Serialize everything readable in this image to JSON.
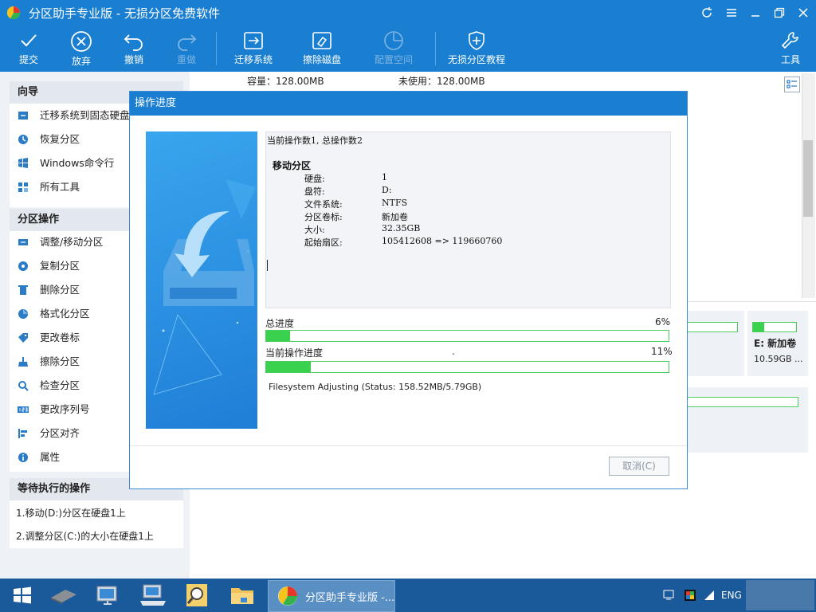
{
  "window": {
    "title": "分区助手专业版 - 无损分区免费软件"
  },
  "titlebar_controls": [
    "refresh-icon",
    "menu-icon",
    "minimize-icon",
    "restore-icon",
    "close-icon"
  ],
  "toolbar": {
    "commit": "提交",
    "discard": "放弃",
    "undo": "撤销",
    "redo": "重做",
    "migrate_os": "迁移系统",
    "wipe_disk": "擦除磁盘",
    "alloc_space": "配置空间",
    "tutorial": "无损分区教程",
    "tools": "工具"
  },
  "sidebar": {
    "wizard_header": "向导",
    "wizard_items": [
      "迁移系统到固态硬盘",
      "恢复分区",
      "Windows命令行",
      "所有工具"
    ],
    "partition_header": "分区操作",
    "partition_items": [
      "调整/移动分区",
      "复制分区",
      "删除分区",
      "格式化分区",
      "更改卷标",
      "擦除分区",
      "检查分区",
      "更改序列号",
      "分区对齐",
      "属性"
    ],
    "pending_header": "等待执行的操作",
    "pending_items": [
      "1.移动(D:)分区在硬盘1上",
      "2.调整分区(C:)的大小在硬盘1上"
    ]
  },
  "disk_info": {
    "capacity": "容量：128.00MB",
    "unused": "未使用：128.00MB"
  },
  "disk_map": {
    "e_label": "E: 新加卷",
    "e_size": "10.59GB ...",
    "e_usage_fraction": 0.25
  },
  "dialog": {
    "title": "操作进度",
    "log": {
      "header": "当前操作数1, 总操作数2",
      "op_title": "移动分区",
      "rows": [
        {
          "k": "硬盘:",
          "v": "1"
        },
        {
          "k": "盘符:",
          "v": "D:"
        },
        {
          "k": "文件系统:",
          "v": "NTFS"
        },
        {
          "k": "分区卷标:",
          "v": "新加卷"
        },
        {
          "k": "大小:",
          "v": "32.35GB"
        },
        {
          "k": "起始扇区:",
          "v": "105412608 => 119660760"
        }
      ]
    },
    "total_progress_label": "总进度",
    "total_progress_pct": "6%",
    "total_progress_value": 0.06,
    "current_progress_label": "当前操作进度",
    "current_progress_dot": ".",
    "current_progress_pct": "11%",
    "current_progress_value": 0.11,
    "status": "Filesystem Adjusting (Status: 158.52MB/5.79GB)",
    "cancel_label": "取消(C)"
  },
  "taskbar": {
    "active_label": "分区助手专业版 -...",
    "lang": "ENG"
  }
}
